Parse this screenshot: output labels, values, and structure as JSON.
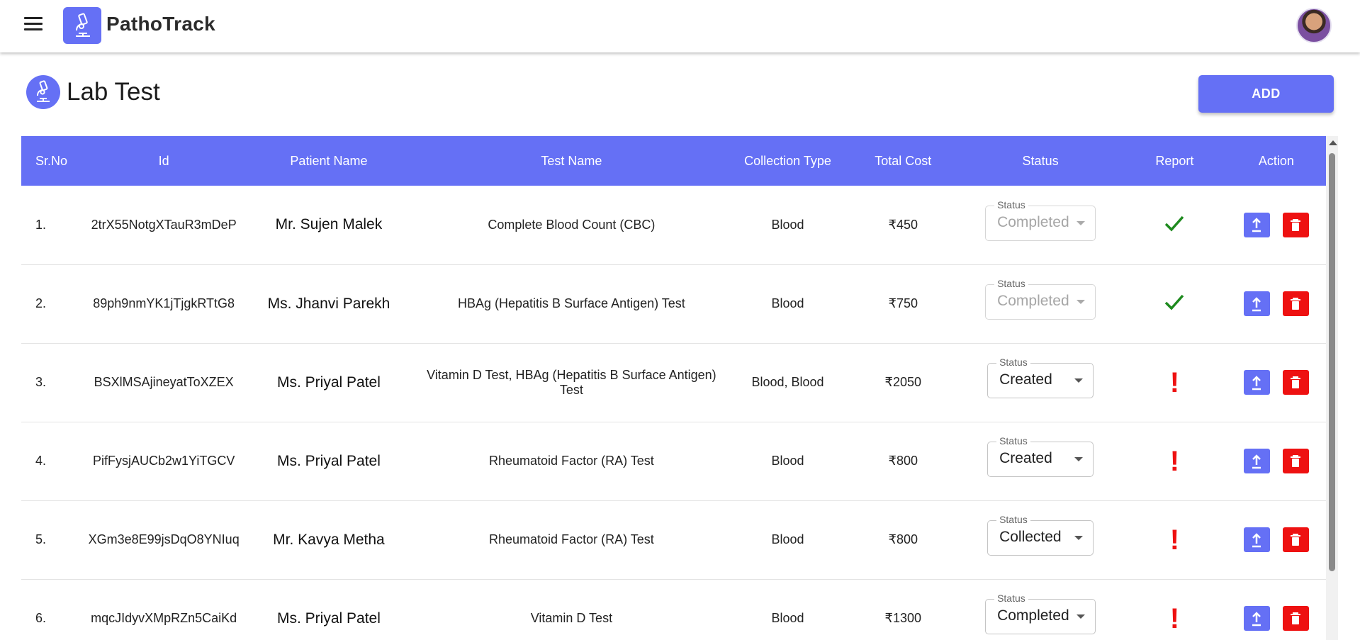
{
  "app": {
    "title": "PathoTrack"
  },
  "page": {
    "title": "Lab Test",
    "add_label": "ADD"
  },
  "table": {
    "headers": [
      "Sr.No",
      "Id",
      "Patient Name",
      "Test Name",
      "Collection Type",
      "Total Cost",
      "Status",
      "Report",
      "Action"
    ],
    "status_legend": "Status",
    "rows": [
      {
        "srno": "1.",
        "id": "2trX55NotgXTauR3mDeP",
        "patient": "Mr. Sujen Malek",
        "test": "Complete Blood Count (CBC)",
        "collection": "Blood",
        "cost": "₹450",
        "status": "Completed",
        "report": "check"
      },
      {
        "srno": "2.",
        "id": "89ph9nmYK1jTjgkRTtG8",
        "patient": "Ms. Jhanvi Parekh",
        "test": "HBAg (Hepatitis B Surface Antigen) Test",
        "collection": "Blood",
        "cost": "₹750",
        "status": "Completed",
        "report": "check"
      },
      {
        "srno": "3.",
        "id": "BSXlMSAjineyatToXZEX",
        "patient": "Ms. Priyal Patel",
        "test": "Vitamin D Test, HBAg (Hepatitis B Surface Antigen) Test",
        "collection": "Blood, Blood",
        "cost": "₹2050",
        "status": "Created",
        "report": "alert"
      },
      {
        "srno": "4.",
        "id": "PifFysjAUCb2w1YiTGCV",
        "patient": "Ms. Priyal Patel",
        "test": "Rheumatoid Factor (RA) Test",
        "collection": "Blood",
        "cost": "₹800",
        "status": "Created",
        "report": "alert"
      },
      {
        "srno": "5.",
        "id": "XGm3e8E99jsDqO8YNIuq",
        "patient": "Mr. Kavya Metha",
        "test": "Rheumatoid Factor (RA) Test",
        "collection": "Blood",
        "cost": "₹800",
        "status": "Collected",
        "report": "alert"
      },
      {
        "srno": "6.",
        "id": "mqcJIdyvXMpRZn5CaiKd",
        "patient": "Ms. Priyal Patel",
        "test": "Vitamin D Test",
        "collection": "Blood",
        "cost": "₹1300",
        "status": "Completed",
        "report": "alert"
      }
    ]
  },
  "colors": {
    "primary": "#6570f5",
    "danger": "#ee1111",
    "success": "#1e8a1e"
  },
  "icons": {
    "menu": "hamburger-icon",
    "logo": "microscope-icon",
    "upload": "upload-icon",
    "delete": "trash-icon",
    "report_ok": "check-icon",
    "report_pending": "exclamation-icon"
  }
}
